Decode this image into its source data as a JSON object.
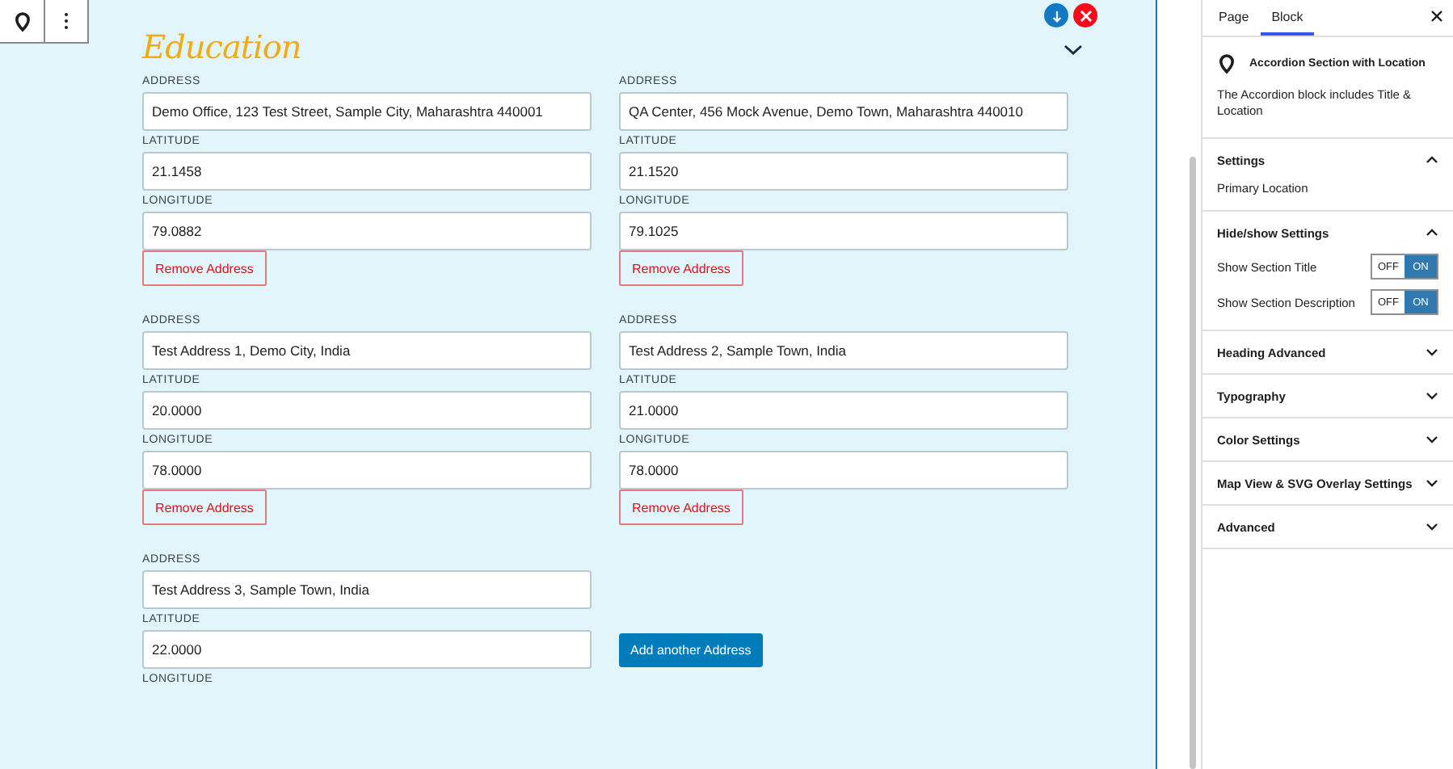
{
  "section": {
    "title": "Education",
    "expanded": false
  },
  "addresses": [
    {
      "fields": [
        {
          "label": "ADDRESS",
          "value": "Demo Office, 123 Test Street, Sample City, Maharashtra 440001"
        },
        {
          "label": "LATITUDE",
          "value": "21.1458"
        },
        {
          "label": "LONGITUDE",
          "value": "79.0882"
        }
      ],
      "remove_button": "Remove Address"
    },
    {
      "fields": [
        {
          "label": "ADDRESS",
          "value": "QA Center, 456 Mock Avenue, Demo Town, Maharashtra 440010"
        },
        {
          "label": "LATITUDE",
          "value": "21.1520"
        },
        {
          "label": "LONGITUDE",
          "value": "79.1025"
        }
      ],
      "remove_button": "Remove Address"
    },
    {
      "fields": [
        {
          "label": "ADDRESS",
          "value": "Test Address 1, Demo City, India"
        },
        {
          "label": "LATITUDE",
          "value": "20.0000"
        },
        {
          "label": "LONGITUDE",
          "value": "78.0000"
        }
      ],
      "remove_button": "Remove Address"
    },
    {
      "fields": [
        {
          "label": "ADDRESS",
          "value": "Test Address 2, Sample Town, India"
        },
        {
          "label": "LATITUDE",
          "value": "21.0000"
        },
        {
          "label": "LONGITUDE",
          "value": "78.0000"
        }
      ],
      "remove_button": "Remove Address"
    },
    {
      "fields": [
        {
          "label": "ADDRESS",
          "value": "Test Address 3, Sample Town, India"
        },
        {
          "label": "LATITUDE",
          "value": "22.0000"
        },
        {
          "label": "LONGITUDE"
        }
      ]
    }
  ],
  "add_button": "Add another Address",
  "sidebar": {
    "tabs": [
      {
        "label": "Page",
        "selected": false
      },
      {
        "label": "Block",
        "selected": true
      }
    ],
    "block": {
      "title": "Accordion Section with Location",
      "description": "The Accordion block includes Title & Location"
    },
    "panels": [
      {
        "title": "Settings",
        "expanded": true,
        "items": [
          {
            "kind": "text",
            "label": "Primary Location"
          }
        ]
      },
      {
        "title": "Hide/show Settings",
        "expanded": true,
        "items": [
          {
            "kind": "toggle",
            "label": "Show Section Title",
            "off_label": "OFF",
            "on_label": "ON",
            "on": true
          },
          {
            "kind": "toggle",
            "label": "Show Section Description",
            "off_label": "OFF",
            "on_label": "ON",
            "on": true
          }
        ]
      },
      {
        "title": "Heading Advanced",
        "expanded": false
      },
      {
        "title": "Typography",
        "expanded": false
      },
      {
        "title": "Color Settings",
        "expanded": false
      },
      {
        "title": "Map View & SVG Overlay Settings",
        "expanded": false
      },
      {
        "title": "Advanced",
        "expanded": false
      }
    ]
  }
}
